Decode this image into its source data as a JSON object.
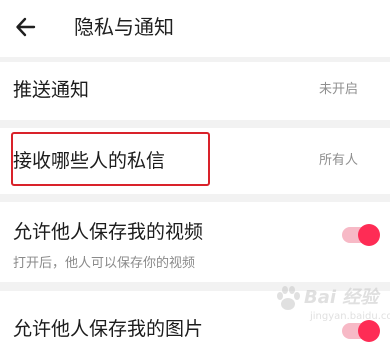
{
  "header": {
    "title": "隐私与通知"
  },
  "rows": {
    "push": {
      "label": "推送通知",
      "value": "未开启"
    },
    "messages": {
      "label": "接收哪些人的私信",
      "value": "所有人"
    },
    "save_video": {
      "label": "允许他人保存我的视频",
      "sub": "打开后，他人可以保存你的视频",
      "enabled": true
    },
    "save_image": {
      "label": "允许他人保存我的图片",
      "enabled": true
    }
  },
  "watermark": {
    "text": "Bai 经验",
    "url": "jingyan.baidu.com"
  },
  "colors": {
    "accent": "#fe2c55",
    "accent_track": "#f7b9c6",
    "highlight_box": "#d9222a",
    "background": "#f2f2f2"
  },
  "icons": {
    "back": "arrow-left-icon",
    "watermark": "baidu-paw-icon"
  }
}
